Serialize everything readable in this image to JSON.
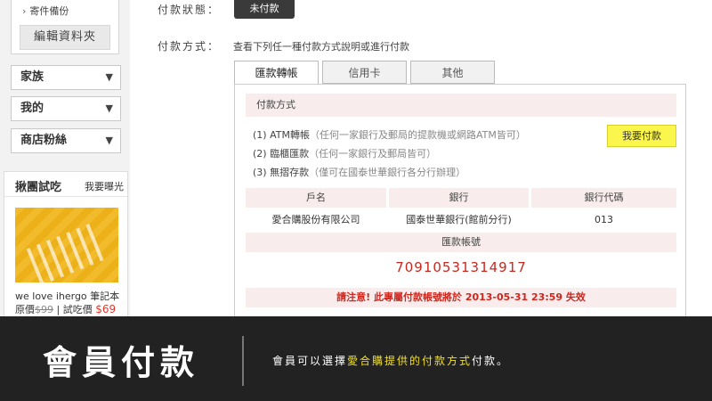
{
  "sidebar": {
    "backup_item": "寄件備份",
    "backup_arrow": "›",
    "edit_folder_button": "編輯資料夾",
    "menus": [
      {
        "label": "家族",
        "arrow": "▼"
      },
      {
        "label": "我的",
        "arrow": "▼"
      },
      {
        "label": "商店粉絲",
        "arrow": "▼"
      }
    ],
    "trial": {
      "title": "揪團試吃",
      "more": "我要曝光",
      "product_name": "we love ihergo 筆記本",
      "original_label": "原價",
      "original_price": "$99",
      "separator": " | ",
      "trial_label": "試吃價",
      "trial_price": "$69"
    }
  },
  "main": {
    "status_label": "付款狀態：",
    "status_value": "未付款",
    "method_label": "付款方式：",
    "method_desc": "查看下列任一種付款方式說明或進行付款",
    "tabs": [
      {
        "label": "匯款轉帳",
        "active": true
      },
      {
        "label": "信用卡",
        "active": false
      },
      {
        "label": "其他",
        "active": false
      }
    ],
    "panel": {
      "header": "付款方式",
      "pay_button": "我要付款",
      "options": [
        {
          "text": "(1) ATM轉帳",
          "note": "（任何一家銀行及郵局的提款機或網路ATM皆可）"
        },
        {
          "text": "(2) 臨櫃匯款",
          "note": "（任何一家銀行及郵局皆可）"
        },
        {
          "text": "(3) 無摺存款",
          "note": "（僅可在國泰世華銀行各分行辦理）"
        }
      ],
      "table": {
        "headers": [
          "戶名",
          "銀行",
          "銀行代碼"
        ],
        "row": [
          "愛合購股份有限公司",
          "國泰世華銀行(館前分行)",
          "013"
        ]
      },
      "account_header": "匯款帳號",
      "account_number": "70910531314917",
      "warning": "請注意! 此專屬付款帳號將於 2013-05-31 23:59 失效"
    }
  },
  "caption": {
    "title": "會員付款",
    "text_before": "會員可以選擇",
    "text_highlight": "愛合購提供的付款方式",
    "text_after": "付款。",
    "highlight_color": "#f3e021"
  }
}
